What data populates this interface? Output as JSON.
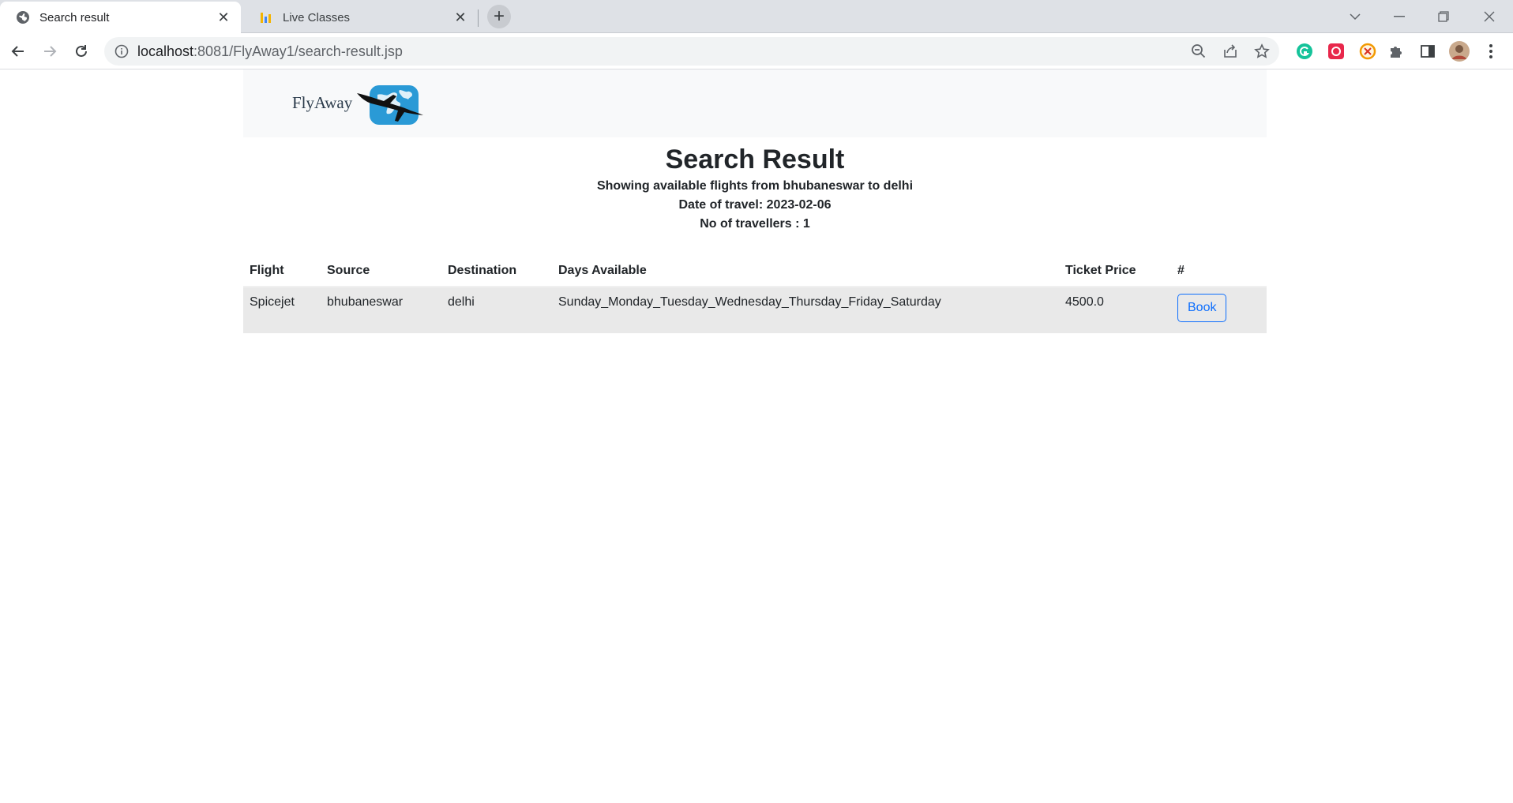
{
  "browser": {
    "tabs": [
      {
        "title": "Search result",
        "active": true
      },
      {
        "title": "Live Classes",
        "active": false
      }
    ],
    "url_host": "localhost",
    "url_rest": ":8081/FlyAway1/search-result.jsp"
  },
  "navbar": {
    "brand": "FlyAway"
  },
  "main": {
    "title": "Search Result",
    "route_line": "Showing available flights from bhubaneswar to delhi",
    "date_line": "Date of travel: 2023-02-06",
    "travellers_line": "No of travellers : 1"
  },
  "table": {
    "headers": {
      "flight": "Flight",
      "source": "Source",
      "destination": "Destination",
      "days": "Days Available",
      "price": "Ticket Price",
      "action": "#"
    },
    "rows": [
      {
        "flight": "Spicejet",
        "source": "bhubaneswar",
        "destination": "delhi",
        "days": "Sunday_Monday_Tuesday_Wednesday_Thursday_Friday_Saturday",
        "price": "4500.0",
        "action_label": "Book"
      }
    ]
  },
  "colors": {
    "accent": "#0d6efd",
    "row_bg": "#e9e9e9",
    "navbar_bg": "#f8f9fa",
    "logo_blue": "#2a9ad6"
  }
}
